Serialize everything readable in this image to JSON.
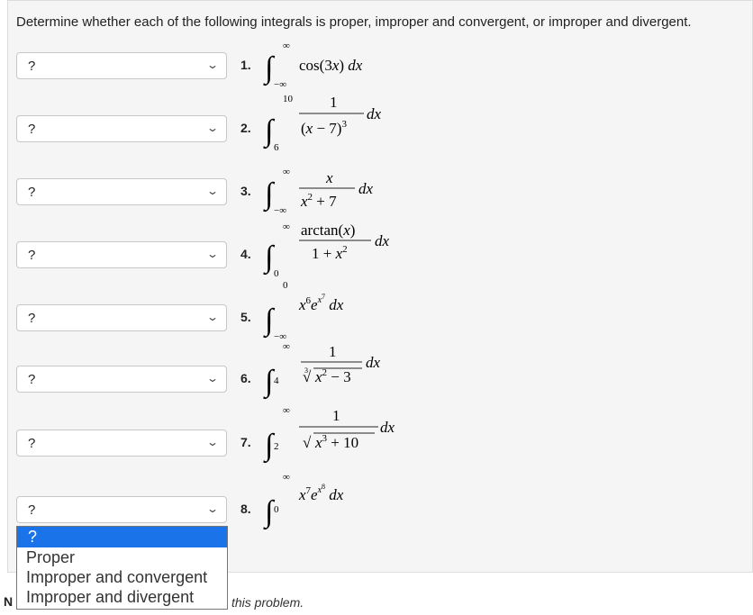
{
  "instructions": "Determine whether each of the following integrals is proper, improper and convergent, or improper and divergent.",
  "problems": [
    {
      "number": "1.",
      "answer": "?",
      "lower": "−∞",
      "upper": "∞",
      "integrand": "cos(3x) dx"
    },
    {
      "number": "2.",
      "answer": "?",
      "lower": "6",
      "upper": "10",
      "integrand": "1 / (x − 7)³ dx"
    },
    {
      "number": "3.",
      "answer": "?",
      "lower": "−∞",
      "upper": "∞",
      "integrand": "x / (x² + 7) dx"
    },
    {
      "number": "4.",
      "answer": "?",
      "lower": "0",
      "upper": "∞",
      "integrand": "arctan(x) / (1 + x²) dx"
    },
    {
      "number": "5.",
      "answer": "?",
      "lower": "−∞",
      "upper": "0",
      "integrand": "x⁶ e^(x⁷) dx"
    },
    {
      "number": "6.",
      "answer": "?",
      "lower": "4",
      "upper": "∞",
      "integrand": "1 / ∛(x² − 3) dx"
    },
    {
      "number": "7.",
      "answer": "?",
      "lower": "2",
      "upper": "∞",
      "integrand": "1 / √(x³ + 10) dx"
    },
    {
      "number": "8.",
      "answer": "?",
      "lower": "0",
      "upper": "∞",
      "integrand": "x⁷ e^(x⁸) dx"
    }
  ],
  "dropdown_options": [
    "?",
    "Proper",
    "Improper and convergent",
    "Improper and divergent"
  ],
  "footer": {
    "left": "N",
    "text": "this problem."
  },
  "colors": {
    "highlight": "#1a73e8",
    "panel": "#f5f5f5"
  }
}
